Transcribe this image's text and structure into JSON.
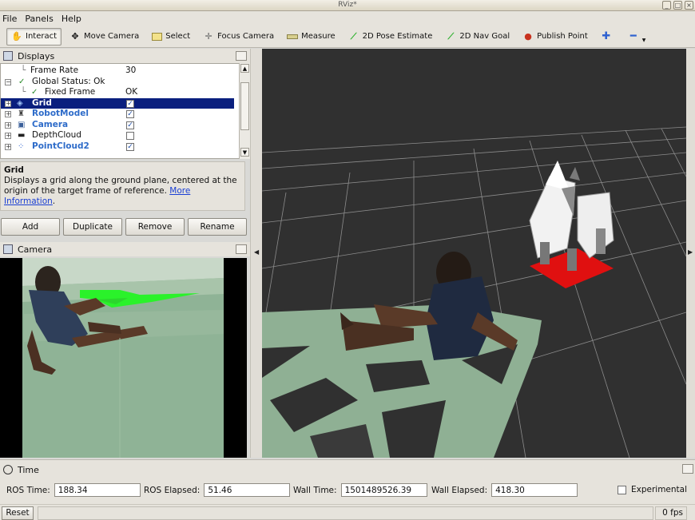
{
  "window": {
    "title": "RViz*"
  },
  "menu": {
    "file": "File",
    "panels": "Panels",
    "help": "Help"
  },
  "toolbar": {
    "interact": "Interact",
    "move_camera": "Move Camera",
    "select": "Select",
    "focus_camera": "Focus Camera",
    "measure": "Measure",
    "pose_estimate": "2D Pose Estimate",
    "nav_goal": "2D Nav Goal",
    "publish_point": "Publish Point"
  },
  "displays": {
    "title": "Displays",
    "rows": [
      {
        "name": "Frame Rate",
        "value": "30"
      },
      {
        "name": "Global Status: Ok",
        "value": ""
      },
      {
        "name": "Fixed Frame",
        "value": "OK"
      },
      {
        "name": "Grid",
        "checked": true
      },
      {
        "name": "RobotModel",
        "checked": true
      },
      {
        "name": "Camera",
        "checked": true
      },
      {
        "name": "DepthCloud",
        "checked": false
      },
      {
        "name": "PointCloud2",
        "checked": true
      }
    ]
  },
  "description": {
    "title": "Grid",
    "text": "Displays a grid along the ground plane, centered at the origin of the target frame of reference.",
    "link": "More Information"
  },
  "buttons": {
    "add": "Add",
    "duplicate": "Duplicate",
    "remove": "Remove",
    "rename": "Rename"
  },
  "camera_panel": {
    "title": "Camera"
  },
  "time_panel": {
    "title": "Time",
    "ros_time_label": "ROS Time:",
    "ros_time": "188.34",
    "ros_elapsed_label": "ROS Elapsed:",
    "ros_elapsed": "51.46",
    "wall_time_label": "Wall Time:",
    "wall_time": "1501489526.39",
    "wall_elapsed_label": "Wall Elapsed:",
    "wall_elapsed": "418.30",
    "experimental": "Experimental"
  },
  "status": {
    "reset": "Reset",
    "fps": "0 fps"
  },
  "colors": {
    "selection": "#0a1f7e",
    "point_cloud": "#8fb094",
    "grid_line": "#9a9a9a",
    "robot_base": "#e01010",
    "camera_bg": "#8fb396"
  }
}
